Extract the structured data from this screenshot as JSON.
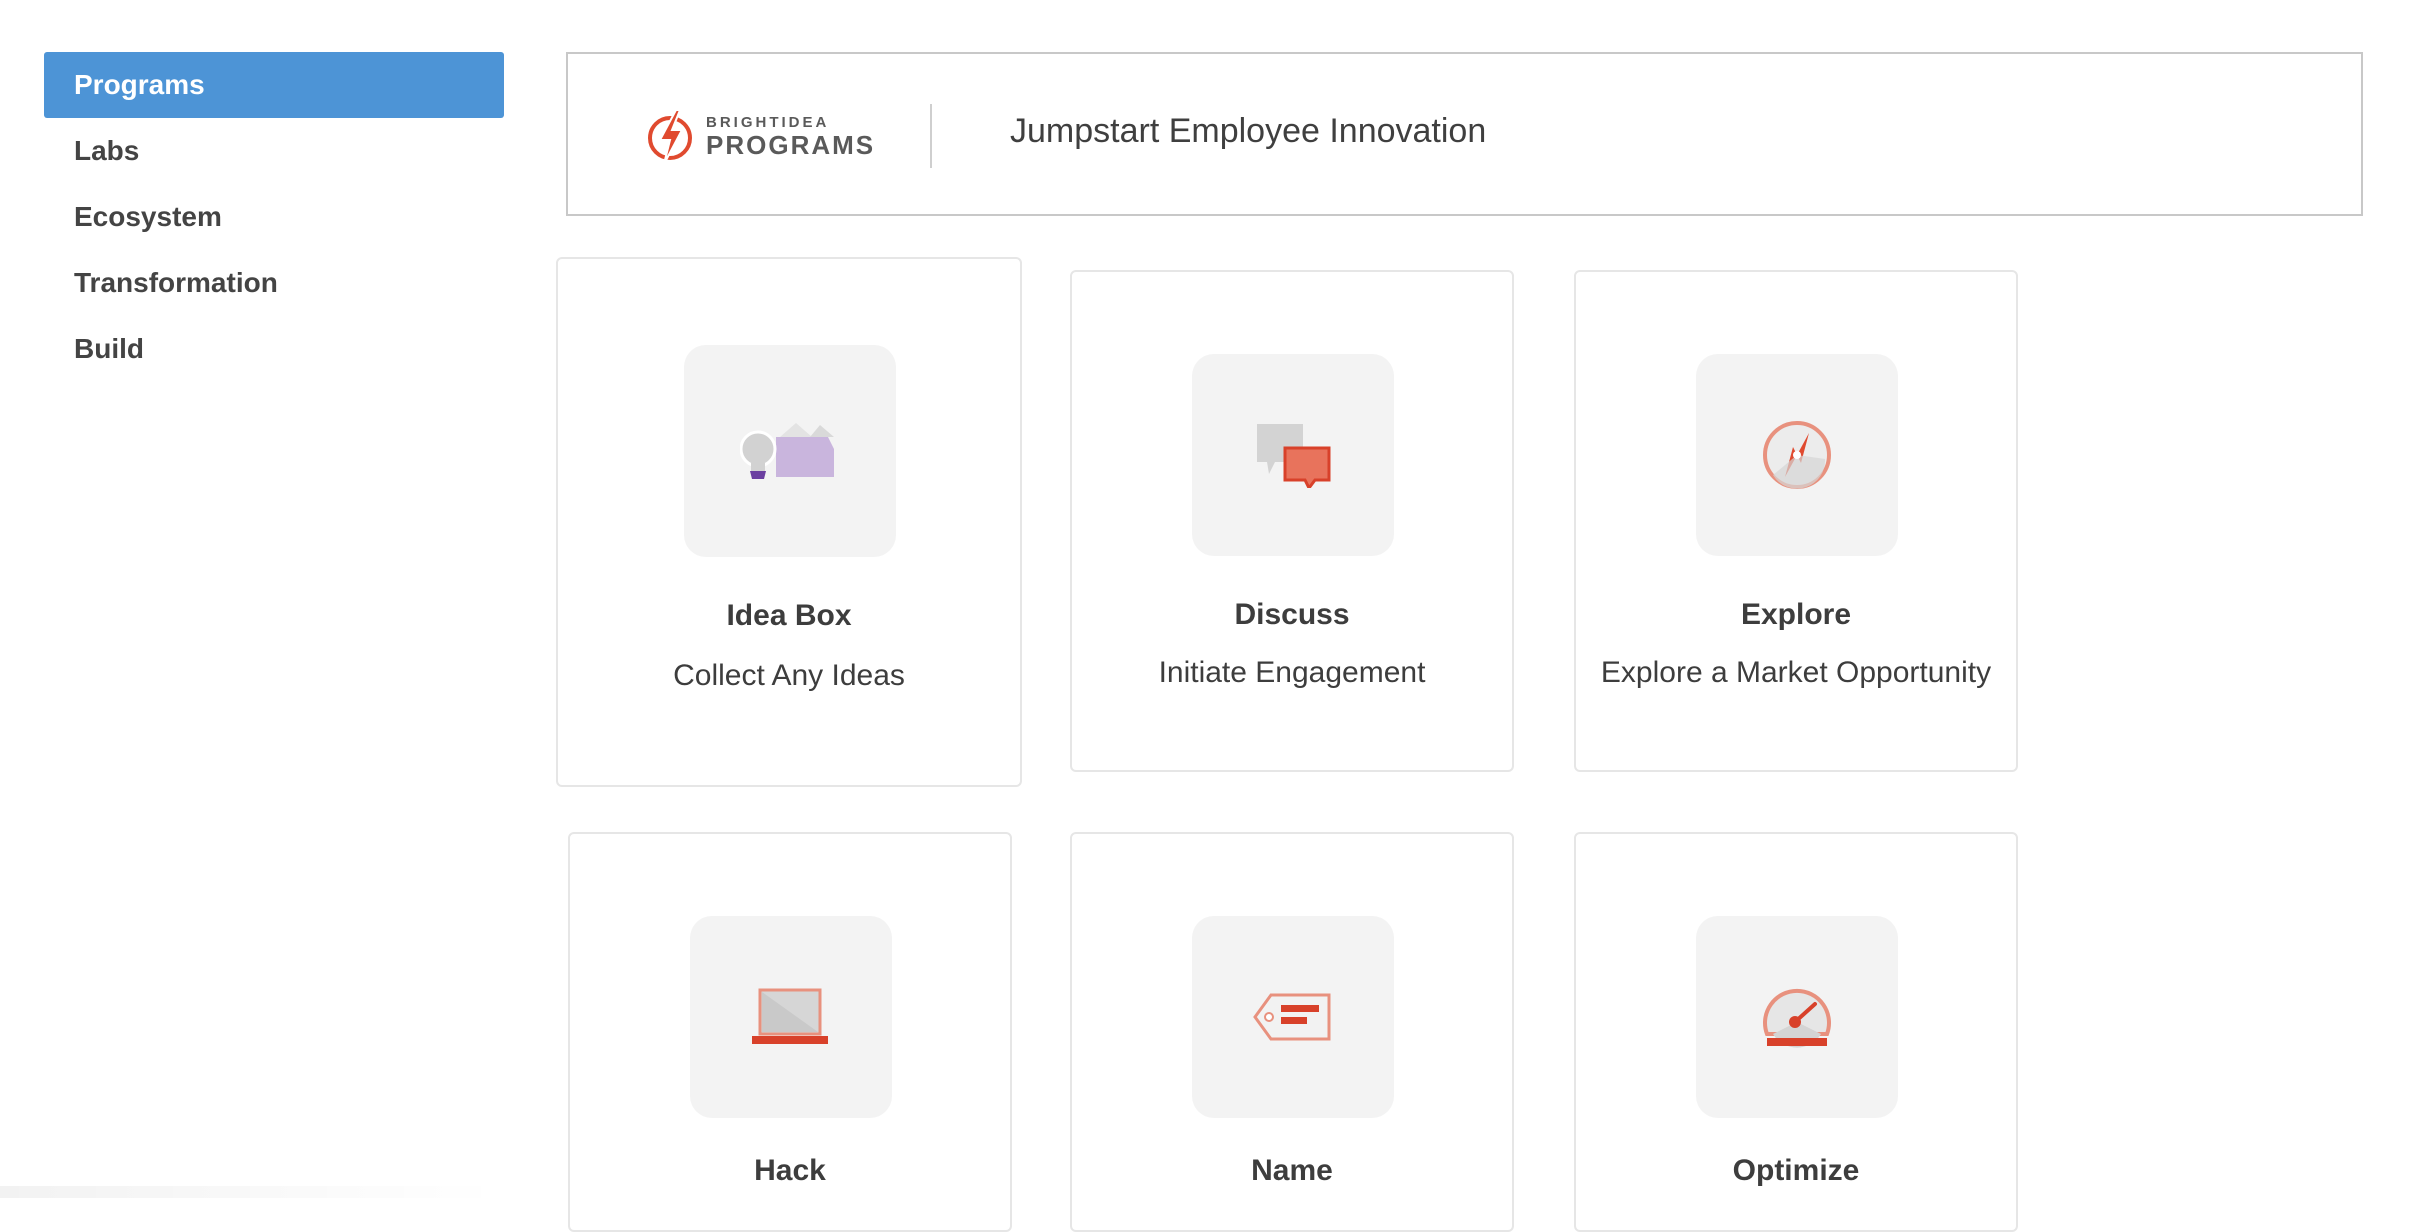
{
  "sidebar": {
    "items": [
      {
        "label": "Programs",
        "active": true
      },
      {
        "label": "Labs",
        "active": false
      },
      {
        "label": "Ecosystem",
        "active": false
      },
      {
        "label": "Transformation",
        "active": false
      },
      {
        "label": "Build",
        "active": false
      }
    ],
    "active_color": "#4d94d6"
  },
  "header": {
    "brand_top": "BRIGHTIDEA",
    "brand_bottom": "PROGRAMS",
    "title": "Jumpstart Employee Innovation",
    "brand_icon": "lightning-bolt-icon",
    "brand_color": "#e04a2f"
  },
  "cards": [
    {
      "title": "Idea Box",
      "subtitle": "Collect Any Ideas",
      "icon": "idea-box-icon"
    },
    {
      "title": "Discuss",
      "subtitle": "Initiate Engagement",
      "icon": "chat-bubbles-icon"
    },
    {
      "title": "Explore",
      "subtitle": "Explore a Market Opportunity",
      "icon": "compass-icon"
    },
    {
      "title": "Hack",
      "subtitle": "",
      "icon": "laptop-icon"
    },
    {
      "title": "Name",
      "subtitle": "",
      "icon": "tag-icon"
    },
    {
      "title": "Optimize",
      "subtitle": "",
      "icon": "gauge-icon"
    }
  ]
}
